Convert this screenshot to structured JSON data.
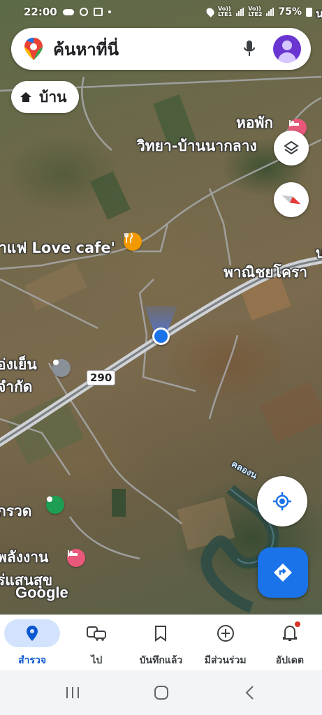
{
  "status_bar": {
    "time": "22:00",
    "battery": "75%",
    "sim1": "LTE1",
    "sim2": "LTE2",
    "volte": "Vo))"
  },
  "search": {
    "placeholder": "ค้นหาที่นี่",
    "icons": [
      "maps-pin-icon",
      "mic-icon",
      "avatar"
    ]
  },
  "home_chip": {
    "label": "บ้าน",
    "icon": "home-icon"
  },
  "map": {
    "labels": {
      "hopak": "หอพัก",
      "wittaya": "วิทยา-บ้านนากลาง",
      "lovecafe": "าแฟ Love cafe'",
      "phanit": "พาณิชยโครา",
      "tong": "อ่งเย็น",
      "jamkat": "จำกัด",
      "kriwot": "กรวด",
      "phalang": "พลังงาน",
      "saensuk": "ร่แสนสุข",
      "khlong": "คลองน",
      "right1": "บ",
      "right2": "น",
      "google": "Google"
    },
    "highway": "290"
  },
  "controls": {
    "layers": "layers-icon",
    "compass": "compass-icon",
    "locate": "my-location-icon",
    "directions": "directions-icon"
  },
  "bottom_nav": [
    {
      "label": "สำรวจ",
      "icon": "explore-pin-icon",
      "active": true
    },
    {
      "label": "ไป",
      "icon": "commute-icon",
      "active": false
    },
    {
      "label": "บันทึกแล้ว",
      "icon": "bookmark-icon",
      "active": false
    },
    {
      "label": "มีส่วนร่วม",
      "icon": "add-circle-icon",
      "active": false
    },
    {
      "label": "อัปเดต",
      "icon": "bell-icon",
      "active": false
    }
  ],
  "colors": {
    "accent": "#1a73e8",
    "active_nav_bg": "#d3e3fd",
    "active_nav_text": "#0b57d0"
  }
}
